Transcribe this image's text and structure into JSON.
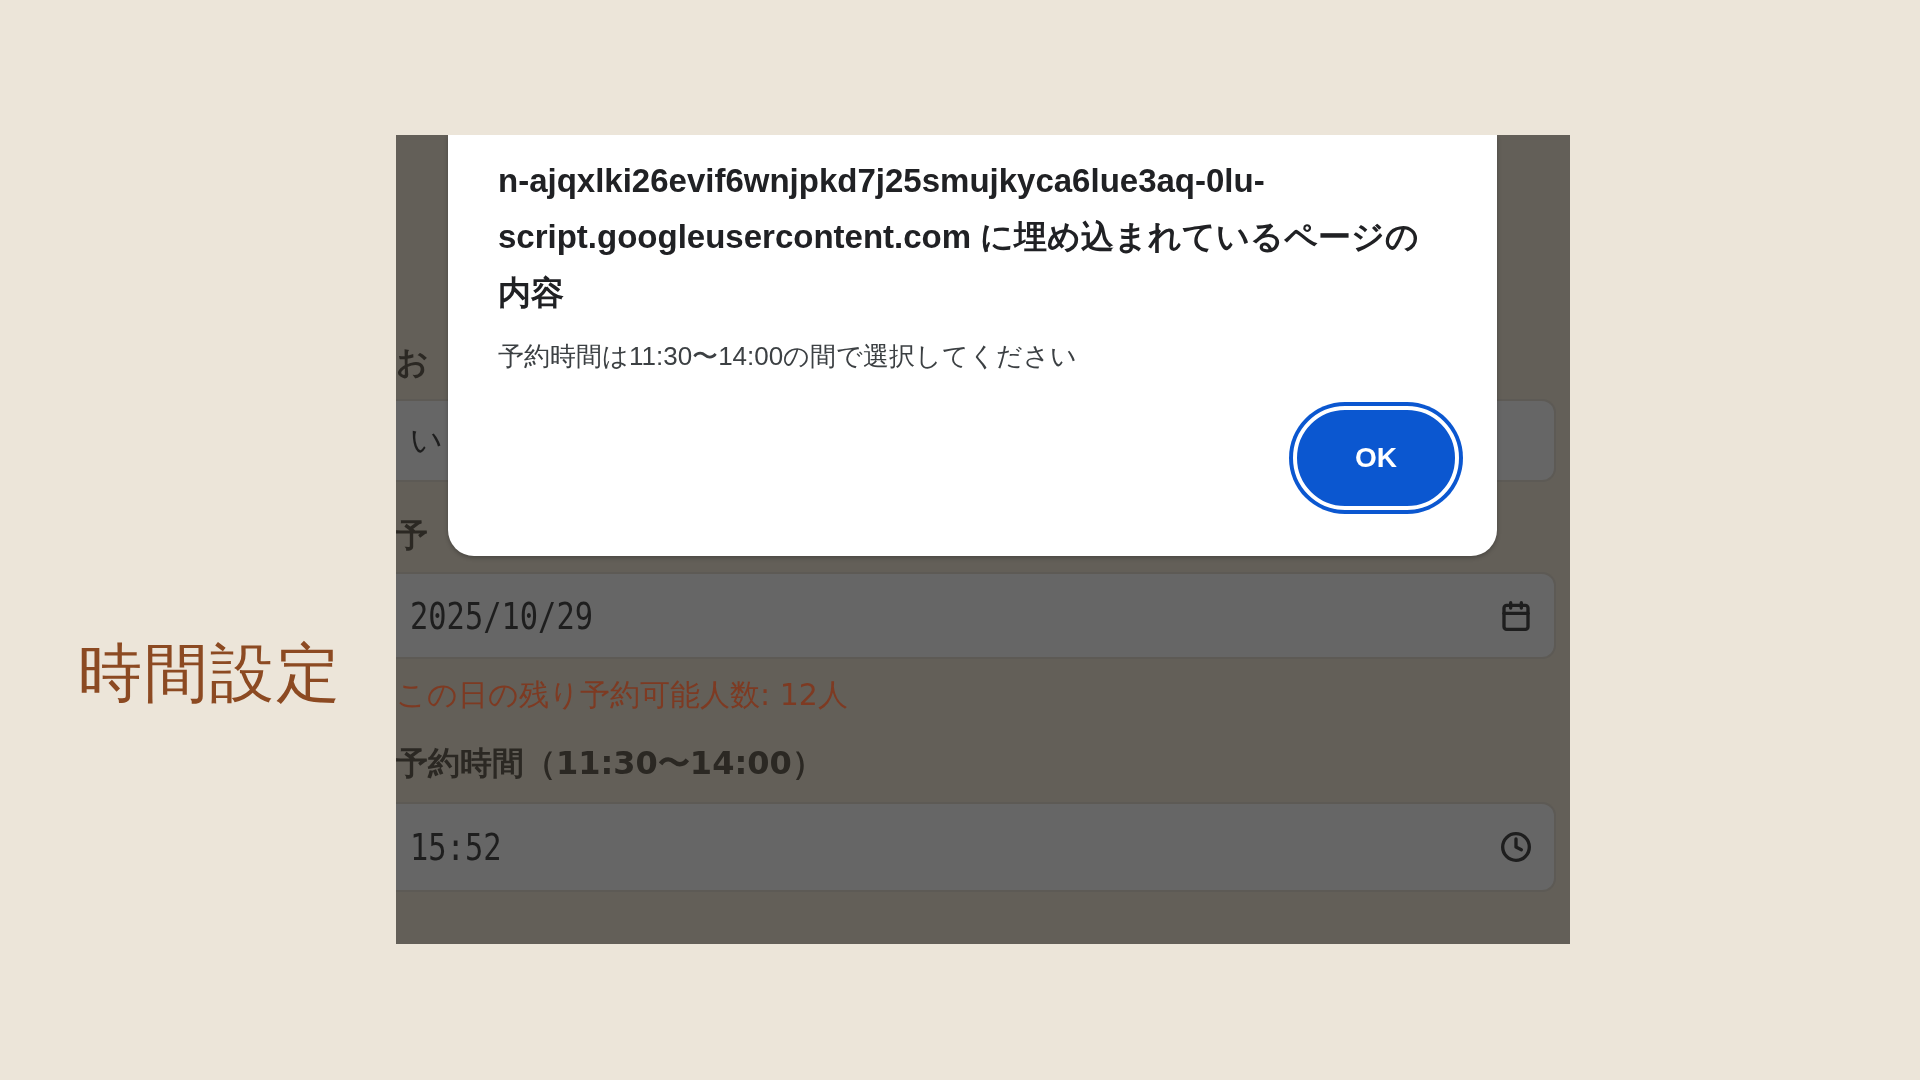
{
  "slide_title": "時間設定",
  "form": {
    "name_label": "お",
    "name_value": "い",
    "date_label": "予",
    "date_value": "2025/10/29",
    "date_note": "この日の残り予約可能人数: 12人",
    "time_label": "予約時間（11:30〜14:00）",
    "time_value": "15:52"
  },
  "dialog": {
    "title": "n-ajqxlki26evif6wnjpkd7j25smujkyca6lue3aq-0lu-script.googleusercontent.com に埋め込まれているページの内容",
    "message": "予約時間は11:30〜14:00の間で選択してください",
    "button": "OK"
  }
}
